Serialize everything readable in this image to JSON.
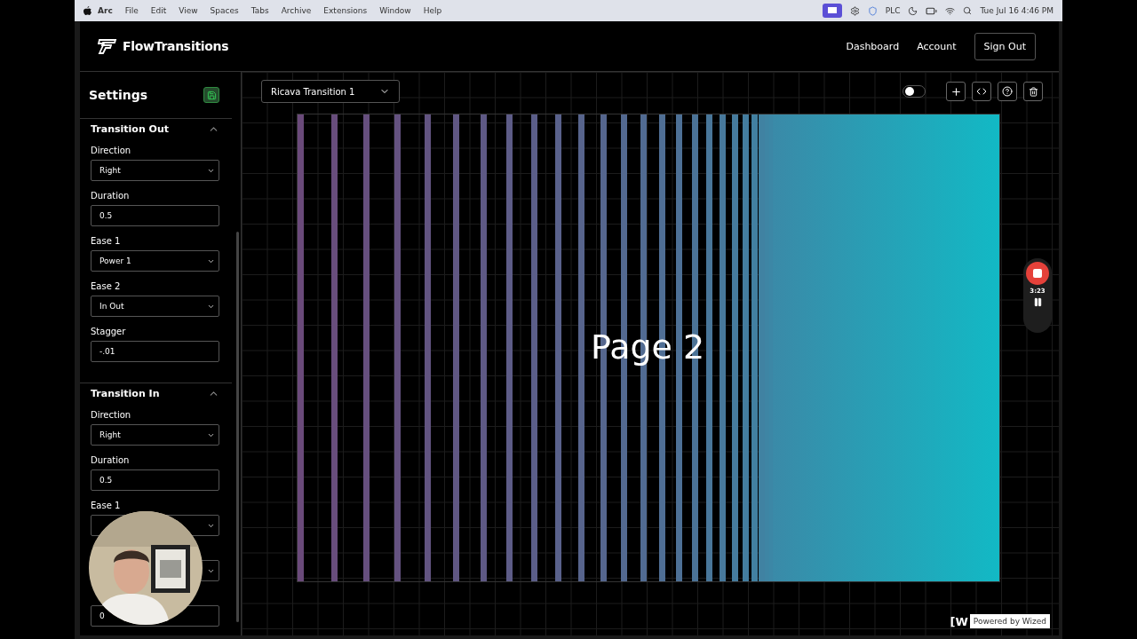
{
  "menu_bar": {
    "app": "Arc",
    "items": [
      "File",
      "Edit",
      "View",
      "Spaces",
      "Tabs",
      "Archive",
      "Extensions",
      "Window",
      "Help"
    ],
    "status_text": "PLC",
    "clock": "Tue Jul 16  4:46 PM"
  },
  "header": {
    "logo": "FlowTransitions",
    "nav": [
      {
        "label": "Dashboard",
        "kind": "link"
      },
      {
        "label": "Account",
        "kind": "link"
      },
      {
        "label": "Sign Out",
        "kind": "button"
      }
    ]
  },
  "sidebar": {
    "title": "Settings",
    "sections": [
      {
        "title": "Transition Out",
        "expanded": true,
        "fields": [
          {
            "label": "Direction",
            "kind": "select",
            "value": "Right"
          },
          {
            "label": "Duration",
            "kind": "input",
            "value": "0.5"
          },
          {
            "label": "Ease 1",
            "kind": "select",
            "value": "Power 1"
          },
          {
            "label": "Ease 2",
            "kind": "select",
            "value": "In Out"
          },
          {
            "label": "Stagger",
            "kind": "input",
            "value": "-.01"
          }
        ]
      },
      {
        "title": "Transition In",
        "expanded": true,
        "fields": [
          {
            "label": "Direction",
            "kind": "select",
            "value": "Right"
          },
          {
            "label": "Duration",
            "kind": "input",
            "value": "0.5"
          },
          {
            "label": "Ease 1",
            "kind": "select"
          },
          {
            "kind": "select"
          },
          {
            "kind": "input",
            "value": "0"
          }
        ]
      }
    ]
  },
  "toolbar": {
    "transition_select": "Ricava Transition 1",
    "preview_toggle": {
      "on": false
    }
  },
  "preview": {
    "page_label": "Page 2"
  },
  "recorder": {
    "time": "3:23"
  },
  "badge": {
    "logo": "[W",
    "text": "Powered by Wized"
  }
}
